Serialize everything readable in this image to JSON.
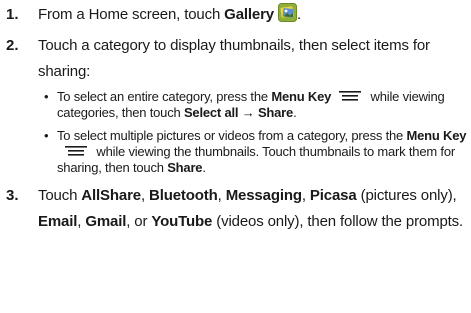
{
  "steps": [
    {
      "number": "1.",
      "text_before": "From a Home screen, touch ",
      "bold1": "Gallery",
      "icon": "gallery-app-icon",
      "text_after": "."
    },
    {
      "number": "2.",
      "text": "Touch a category to display thumbnails, then select items for sharing:",
      "bullets": [
        {
          "text1": "To select an entire category, press the ",
          "bold1": "Menu Key",
          "icon": "menu-key-icon",
          "text2": " while viewing categories, then touch ",
          "bold2": "Select all",
          "arrow": " → ",
          "bold3": "Share",
          "text3": "."
        },
        {
          "text1": "To select multiple pictures or videos from a category, press the ",
          "bold1": "Menu Key",
          "icon": "menu-key-icon",
          "text2": " while viewing the thumbnails. Touch thumbnails to mark them for sharing, then touch ",
          "bold2": "Share",
          "text3": "."
        }
      ]
    },
    {
      "number": "3.",
      "parts": [
        {
          "t": "Touch ",
          "b": false
        },
        {
          "t": "AllShare",
          "b": true
        },
        {
          "t": ", ",
          "b": false
        },
        {
          "t": "Bluetooth",
          "b": true
        },
        {
          "t": ", ",
          "b": false
        },
        {
          "t": "Messaging",
          "b": true
        },
        {
          "t": ", ",
          "b": false
        },
        {
          "t": "Picasa",
          "b": true
        },
        {
          "t": " (pictures only), ",
          "b": false
        },
        {
          "t": "Email",
          "b": true
        },
        {
          "t": ", ",
          "b": false
        },
        {
          "t": "Gmail",
          "b": true
        },
        {
          "t": ", or ",
          "b": false
        },
        {
          "t": "YouTube",
          "b": true
        },
        {
          "t": " (videos only), then follow the prompts.",
          "b": false
        }
      ]
    }
  ],
  "bullet_glyph": "•"
}
